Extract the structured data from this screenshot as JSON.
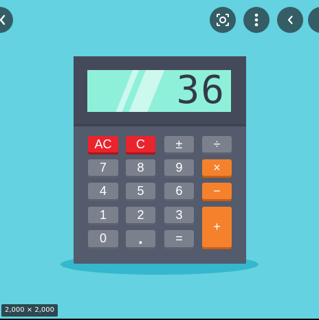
{
  "viewer": {
    "controls": [
      {
        "name": "visual-search-icon"
      },
      {
        "name": "more-options-icon"
      },
      {
        "name": "back-chevron-icon"
      }
    ],
    "size_badge": "2,000 × 2,000"
  },
  "calculator": {
    "display_value": "36",
    "keys": {
      "ac": "AC",
      "c": "C",
      "plus_minus": "±",
      "divide": "÷",
      "seven": "7",
      "eight": "8",
      "nine": "9",
      "multiply": "×",
      "four": "4",
      "five": "5",
      "six": "6",
      "minus": "−",
      "one": "1",
      "two": "2",
      "three": "3",
      "plus": "+",
      "zero": "0",
      "dot": ".",
      "equals": "="
    },
    "colors": {
      "background": "#64d2e0",
      "body": "#545b6c",
      "screen": "#8ff0d9",
      "key_gray": "#7b808d",
      "key_red": "#e9242c",
      "key_orange": "#f5812d"
    }
  }
}
